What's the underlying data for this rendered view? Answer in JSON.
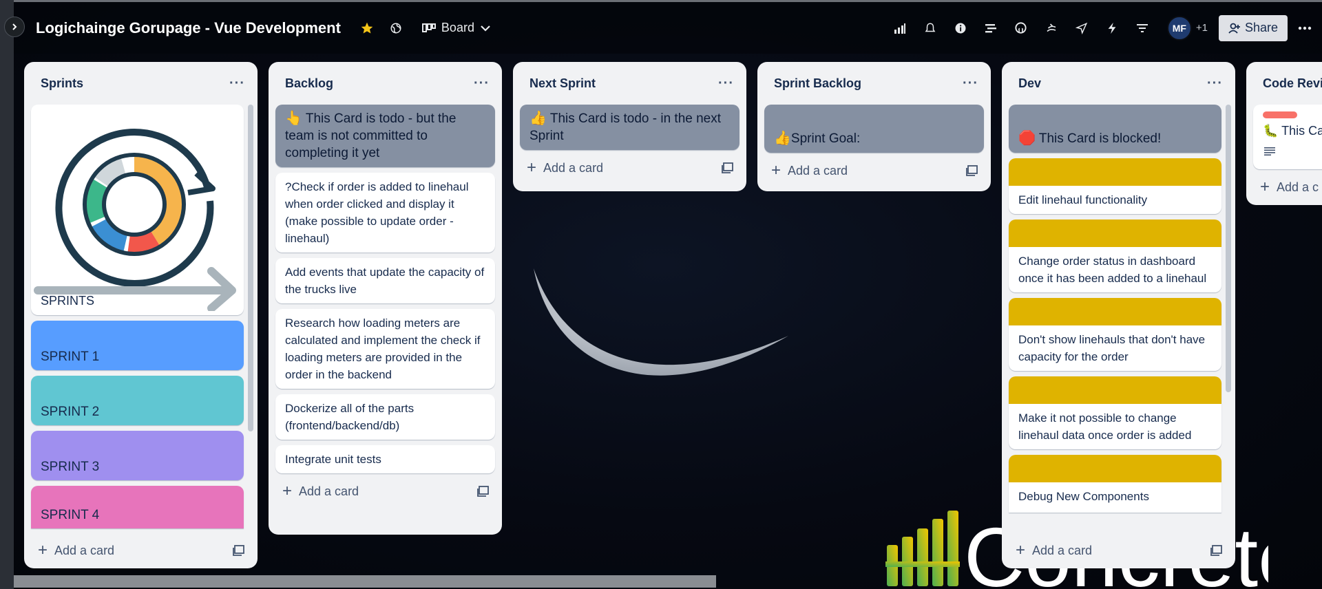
{
  "header": {
    "board_title": "Logichainge Gorupage - Vue Development",
    "view_label": "Board",
    "avatar_initials": "MF",
    "extra_members": "+1",
    "share_label": "Share",
    "icons": [
      "star-icon",
      "globe-icon",
      "board-view-icon",
      "chevron-down-icon",
      "signal-icon",
      "bell-icon",
      "info-icon",
      "timeline-icon",
      "github-icon",
      "slack-icon",
      "send-icon",
      "automation-icon",
      "filter-icon",
      "more-icon"
    ],
    "star_color": "#f5c518"
  },
  "lists": {
    "sprints": {
      "title": "Sprints",
      "cover_card_label": "SPRINTS",
      "cards": [
        {
          "label": "SPRINT 1",
          "color": "#579dff"
        },
        {
          "label": "SPRINT 2",
          "color": "#60c6d2"
        },
        {
          "label": "SPRINT 3",
          "color": "#9f8fef"
        },
        {
          "label": "SPRINT 4",
          "color": "#e774bb"
        }
      ],
      "add_label": "Add a card"
    },
    "backlog": {
      "title": "Backlog",
      "header_card": "This Card is todo - but the team is not committed to completing it yet",
      "header_emoji": "👆",
      "cards": [
        "?Check if order is added to linehaul when order clicked and display it (make possible to update order - linehaul)",
        "Add events that update the capacity of the trucks live",
        "Research how loading meters are calculated and implement the check if loading meters are provided in the order in the backend",
        "Dockerize all of the parts (frontend/backend/db)",
        "Integrate unit tests"
      ],
      "add_label": "Add a card"
    },
    "next_sprint": {
      "title": "Next Sprint",
      "header_card": "This Card is todo - in the next Sprint",
      "header_emoji": "👍",
      "add_label": "Add a card"
    },
    "sprint_backlog": {
      "title": "Sprint Backlog",
      "header_card": "Sprint Goal:",
      "header_emoji": "👍",
      "add_label": "Add a card"
    },
    "dev": {
      "title": "Dev",
      "header_card": "This Card is blocked!",
      "header_emoji": "🛑",
      "cover_color": "#dfb300",
      "cards": [
        "Edit linehaul functionality",
        "Change order status in dashboard once it has been added to a linehaul",
        "Don't show linehauls that don't have capacity for the order",
        "Make it not possible to change linehaul data once order is added",
        "Debug New Components"
      ],
      "add_label": "Add a card"
    },
    "code_review": {
      "title": "Code Revie",
      "card_label": "This Ca",
      "card_emoji": "🐛",
      "label_color": "#f87168",
      "add_label": "Add a c"
    }
  },
  "watermark_text": "Concrete"
}
